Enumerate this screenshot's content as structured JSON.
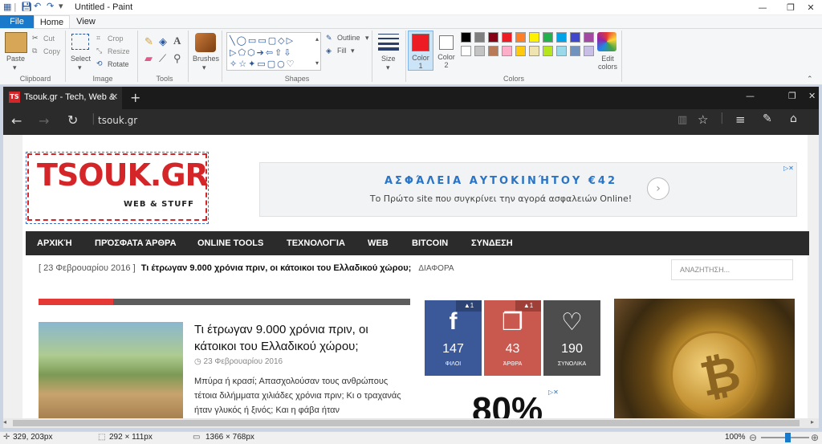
{
  "paint": {
    "title": "Untitled - Paint",
    "tabs": {
      "file": "File",
      "home": "Home",
      "view": "View"
    },
    "clipboard": {
      "paste": "Paste",
      "cut": "Cut",
      "copy": "Copy",
      "group": "Clipboard"
    },
    "image": {
      "select": "Select",
      "crop": "Crop",
      "resize": "Resize",
      "rotate": "Rotate",
      "group": "Image"
    },
    "tools": {
      "group": "Tools"
    },
    "brushes": {
      "label": "Brushes"
    },
    "shapes": {
      "outline": "Outline",
      "fill": "Fill",
      "group": "Shapes"
    },
    "size": {
      "label": "Size"
    },
    "colors": {
      "color1": "Color 1",
      "color2": "Color 2",
      "edit": "Edit colors",
      "group": "Colors",
      "palette_row1": [
        "#000000",
        "#7f7f7f",
        "#880015",
        "#ed1c24",
        "#ff7f27",
        "#fff200",
        "#22b14c",
        "#00a2e8",
        "#3f48cc",
        "#a349a4"
      ],
      "palette_row2": [
        "#ffffff",
        "#c3c3c3",
        "#b97a57",
        "#ffaec9",
        "#ffc90e",
        "#efe4b0",
        "#b5e61d",
        "#99d9ea",
        "#7092be",
        "#c8bfe7"
      ]
    },
    "status": {
      "cursor": "329, 203px",
      "selection": "292 × 111px",
      "canvas": "1366 × 768px",
      "zoom": "100%"
    }
  },
  "browser": {
    "tab_title": "Tsouk.gr - Tech, Web &",
    "url": "tsouk.gr"
  },
  "site": {
    "logo": "TSOUK.GR",
    "logo_sub": "WEB & STUFF",
    "ad_title": "ΑΣΦΆΛΕΙΑ ΑΥΤΟΚΙΝΉΤΟΥ €42",
    "ad_sub": "Το Πρώτο site που συγκρίνει την αγορά ασφαλειών Online!",
    "nav": [
      "ΑΡΧΙΚΉ",
      "ΠΡΌΣΦΑΤΑ ΆΡΘΡΑ",
      "ONLINE TOOLS",
      "ΤΕΧΝΟΛΟΓΊΑ",
      "WEB",
      "BITCOIN",
      "ΣΥΝΔΕΣΗ"
    ],
    "ticker_date": "[ 23 Φεβρουαρίου 2016 ]",
    "ticker_title": "Τι έτρωγαν 9.000 χρόνια πριν, οι κάτοικοι του Ελλαδικού χώρου;",
    "ticker_cat": "ΔΙΑΦΟΡΑ",
    "search_placeholder": "ΑΝΑΖΗΤΗΣΗ...",
    "post_title": "Τι έτρωγαν 9.000 χρόνια πριν, οι κάτοικοι του Ελλαδικού χώρου;",
    "post_date": "23 Φεβρουαρίου 2016",
    "post_excerpt": "Μπύρα ή κρασί; Απασχολούσαν τους ανθρώπους τέτοια διλήμματα χιλιάδες χρόνια πριν; Κι ο τραχανάς ήταν γλυκός ή ξινός; Και η φάβα ήταν",
    "social": [
      {
        "num": "147",
        "label": "ΦΙΛΟΙ",
        "badge": "▲1",
        "icon": "f",
        "color": "#3b5998"
      },
      {
        "num": "43",
        "label": "ΆΡΘΡΑ",
        "badge": "▲1",
        "icon": "❐",
        "color": "#c9584f"
      },
      {
        "num": "190",
        "label": "ΣΥΝΟΛΙΚΑ",
        "badge": "",
        "icon": "♡",
        "color": "#4d4d4d"
      }
    ],
    "big_number": "80%"
  }
}
